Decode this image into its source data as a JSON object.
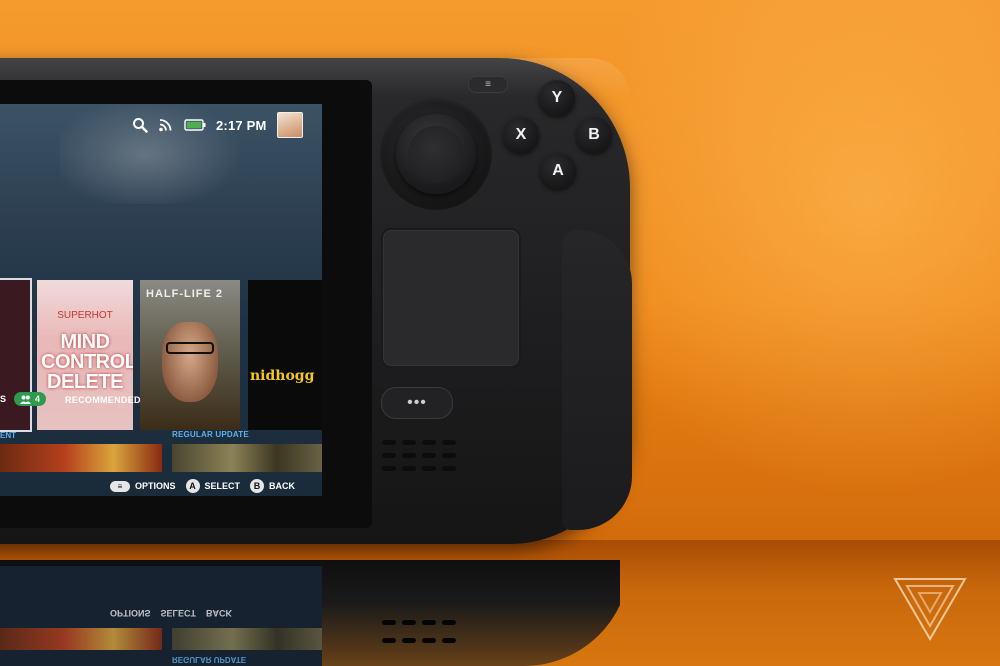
{
  "status_bar": {
    "time": "2:17 PM",
    "icons": [
      "search-icon",
      "wifi-icon",
      "battery-icon"
    ]
  },
  "games": [
    {
      "title": "MIND CONTROL DELETE",
      "pre": "SUPERHOT"
    },
    {
      "title": "HALF-LIFE 2"
    },
    {
      "title": "nidhogg"
    }
  ],
  "tabs": {
    "friends_suffix": "S",
    "friends_count": "4",
    "recommended": "RECOMMENDED"
  },
  "sections": {
    "left_label": "ENT",
    "right_label": "REGULAR UPDATE"
  },
  "hints": {
    "options": "OPTIONS",
    "select_key": "A",
    "select": "SELECT",
    "back_key": "B",
    "back": "BACK"
  },
  "controller": {
    "y": "Y",
    "x": "X",
    "b": "B",
    "a": "A",
    "menu": "≡",
    "quick": "•••"
  },
  "colors": {
    "background": "#ef8a1c",
    "device": "#1d1d1f",
    "accent_blue": "#5fb0ee",
    "friends_green": "#2e9a4b",
    "battery_green": "#4caf50"
  }
}
